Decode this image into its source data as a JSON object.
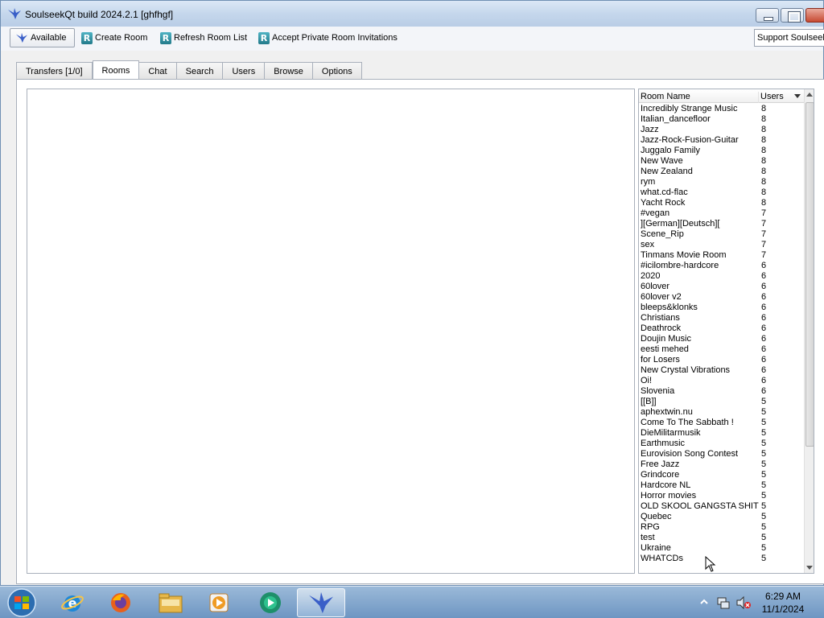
{
  "window": {
    "title": "SoulseekQt build 2024.2.1 [ghfhgf]"
  },
  "toolbar": {
    "status_label": "Available",
    "create_room_label": "Create Room",
    "refresh_label": "Refresh Room List",
    "accept_label": "Accept Private Room Invitations",
    "support_label": "Support Soulseek",
    "r_glyph": "R"
  },
  "tabs": [
    {
      "label": "Transfers [1/0]",
      "active": false
    },
    {
      "label": "Rooms",
      "active": true
    },
    {
      "label": "Chat",
      "active": false
    },
    {
      "label": "Search",
      "active": false
    },
    {
      "label": "Users",
      "active": false
    },
    {
      "label": "Browse",
      "active": false
    },
    {
      "label": "Options",
      "active": false
    }
  ],
  "room_list": {
    "col_name": "Room Name",
    "col_users": "Users",
    "rows": [
      {
        "name": "Incredibly Strange Music",
        "users": "8"
      },
      {
        "name": "Italian_dancefloor",
        "users": "8"
      },
      {
        "name": "Jazz",
        "users": "8"
      },
      {
        "name": "Jazz-Rock-Fusion-Guitar",
        "users": "8"
      },
      {
        "name": "Juggalo Family",
        "users": "8"
      },
      {
        "name": "New Wave",
        "users": "8"
      },
      {
        "name": "New Zealand",
        "users": "8"
      },
      {
        "name": "rym",
        "users": "8"
      },
      {
        "name": "what.cd-flac",
        "users": "8"
      },
      {
        "name": "Yacht Rock",
        "users": "8"
      },
      {
        "name": "#vegan",
        "users": "7"
      },
      {
        "name": "][German][Deutsch][",
        "users": "7"
      },
      {
        "name": "Scene_Rip",
        "users": "7"
      },
      {
        "name": "sex",
        "users": "7"
      },
      {
        "name": "Tinmans Movie Room",
        "users": "7"
      },
      {
        "name": "#icilombre-hardcore",
        "users": "6"
      },
      {
        "name": "2020",
        "users": "6"
      },
      {
        "name": "60lover",
        "users": "6"
      },
      {
        "name": "60lover v2",
        "users": "6"
      },
      {
        "name": "bleeps&klonks",
        "users": "6"
      },
      {
        "name": "Christians",
        "users": "6"
      },
      {
        "name": "Deathrock",
        "users": "6"
      },
      {
        "name": "Doujin Music",
        "users": "6"
      },
      {
        "name": "eesti mehed",
        "users": "6"
      },
      {
        "name": "for Losers",
        "users": "6"
      },
      {
        "name": "New Crystal Vibrations",
        "users": "6"
      },
      {
        "name": "Oi!",
        "users": "6"
      },
      {
        "name": "Slovenia",
        "users": "6"
      },
      {
        "name": "[[B]]",
        "users": "5"
      },
      {
        "name": "aphextwin.nu",
        "users": "5"
      },
      {
        "name": "Come To The Sabbath !",
        "users": "5"
      },
      {
        "name": "DieMilitarmusik",
        "users": "5"
      },
      {
        "name": "Earthmusic",
        "users": "5"
      },
      {
        "name": "Eurovision Song Contest",
        "users": "5"
      },
      {
        "name": "Free Jazz",
        "users": "5"
      },
      {
        "name": "Grindcore",
        "users": "5"
      },
      {
        "name": "Hardcore NL",
        "users": "5"
      },
      {
        "name": "Horror movies",
        "users": "5"
      },
      {
        "name": "OLD SKOOL GANGSTA SHIT",
        "users": "5"
      },
      {
        "name": "Quebec",
        "users": "5"
      },
      {
        "name": "RPG",
        "users": "5"
      },
      {
        "name": "test",
        "users": "5"
      },
      {
        "name": "Ukraine",
        "users": "5"
      },
      {
        "name": "WHATCDs",
        "users": "5"
      }
    ]
  },
  "taskbar": {
    "items": [
      {
        "icon": "internet-explorer-icon"
      },
      {
        "icon": "firefox-icon"
      },
      {
        "icon": "file-explorer-icon"
      },
      {
        "icon": "media-player-icon"
      },
      {
        "icon": "media-app-icon"
      },
      {
        "icon": "soulseek-icon",
        "active": true
      }
    ],
    "time": "6:29 AM",
    "date": "11/1/2024"
  },
  "colors": {
    "accent": "#3a6ea5",
    "r_icon": "#2f8fa0"
  }
}
